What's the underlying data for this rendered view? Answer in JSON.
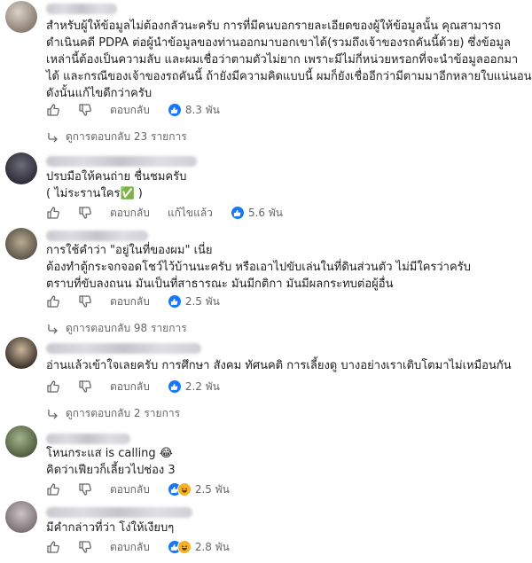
{
  "labels": {
    "reply": "ตอบกลับ",
    "edited": "แก้ไขแล้ว"
  },
  "comments": [
    {
      "lines": [
        "สำหรับผู้ให้ข้อมูลไม่ต้องกลัวนะครับ การที่มีคนบอกรายละเอียดของผู้ให้ข้อมูลนั้น คุณสามารถ",
        "ดำเนินคดี PDPA ต่อผู้นำข้อมูลของท่านออกมาบอกเขาได้(รวมถึงเจ้าของรถคันนี้ด้วย) ซึ่งข้อมูล",
        "เหล่านี้ต้องเป็นความลับ และผมเชื่อว่าตามตัวไม่ยาก เพราะมีไม่กี่หน่วยหรอกที่จะนำข้อมูลออกมา",
        "ได้ และกรณีของเจ้าของรถคันนี้ ถ้ายังมีความคิดแบบนี้ ผมก็ยังเชื่ออีกว่ามีตามมาอีกหลายใบแน่นอน",
        "ดังนั้นแก้ไขดีกว่าครับ"
      ],
      "reaction_count": "8.3 พัน",
      "replies": "ดูการตอบกลับ 23 รายการ"
    },
    {
      "lines": [
        "ปรบมือให้คนถ่าย ชื่นชมครับ",
        "( ไม่ระรานใคร✅ )"
      ],
      "reaction_count": "5.6 พัน"
    },
    {
      "lines": [
        "การใช้คำว่า \"อยู่ในที่ของผม\" เนี่ย",
        "ต้องทำตู้กระจกจอดโชว์ไว้บ้านนะครับ หรือเอาไปขับเล่นในที่ดินส่วนตัว ไม่มีใครว่าครับ",
        "ตราบที่ขับลงถนน มันเป็นที่สาธารณะ มันมีกติกา มันมีผลกระทบต่อผู้อื่น"
      ],
      "reaction_count": "2.5 พัน",
      "replies": "ดูการตอบกลับ 98 รายการ"
    },
    {
      "lines": [
        "อ่านแล้วเข้าใจเลยครับ การศึกษา สังคม ทัศนคติ การเลี้ยงดู บางอย่างเราเติบโตมาไม่เหมือนกัน"
      ],
      "reaction_count": "2.2 พัน",
      "replies": "ดูการตอบกลับ 2 รายการ"
    },
    {
      "lines": [
        "โหนกระแส is calling 😂",
        "คิดว่าเฟียวก็เลี้ยวไปช่อง 3"
      ],
      "reaction_count": "2.5 พัน"
    },
    {
      "lines": [
        "มีคำกล่าวที่ว่า โง่ให้เงียบๆ"
      ],
      "reaction_count": "2.8 พัน"
    }
  ],
  "colors": {
    "like_blue": "#1877f2",
    "haha_yellow": "#f7b125",
    "meta_grey": "#65676b",
    "text": "#1c1e21"
  },
  "icons": [
    "like-icon",
    "dislike-icon",
    "like-reaction-icon",
    "haha-reaction-icon",
    "reply-arrow-icon"
  ]
}
